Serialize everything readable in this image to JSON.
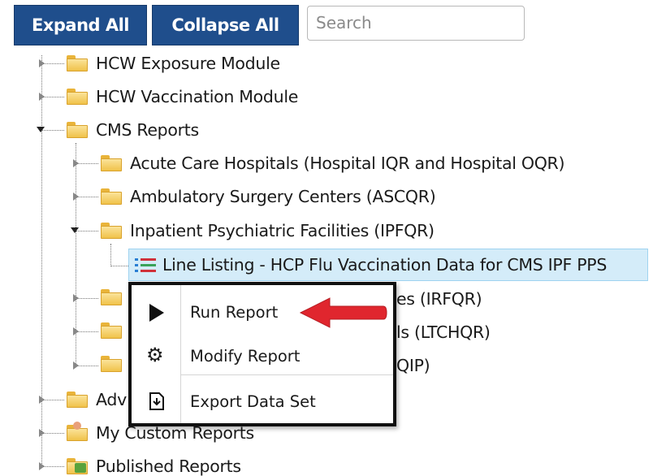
{
  "toolbar": {
    "expand_label": "Expand All",
    "collapse_label": "Collapse All",
    "search_placeholder": "Search"
  },
  "tree": {
    "hcw_exposure": "HCW Exposure Module",
    "hcw_vaccination": "HCW Vaccination Module",
    "cms_reports": "CMS Reports",
    "acute_care": "Acute Care Hospitals (Hospital IQR and Hospital OQR)",
    "ambulatory": "Ambulatory Surgery Centers (ASCQR)",
    "inpatient_psych": "Inpatient Psychiatric Facilities (IPFQR)",
    "line_listing": "Line Listing - HCP Flu Vaccination Data for CMS IPF PPS",
    "irfqr_partial": "es (IRFQR)",
    "ltchqr_partial": "ls (LTCHQR)",
    "qip_partial": "QIP)",
    "adv_partial": "Adv",
    "my_custom": "My Custom Reports",
    "published": "Published Reports"
  },
  "context_menu": {
    "run_report": "Run Report",
    "modify_report": "Modify Report",
    "export_data_set": "Export Data Set"
  },
  "colors": {
    "button_bg": "#1f4e8c",
    "selection_bg": "#d4ecf9",
    "arrow_red": "#e0262e"
  }
}
